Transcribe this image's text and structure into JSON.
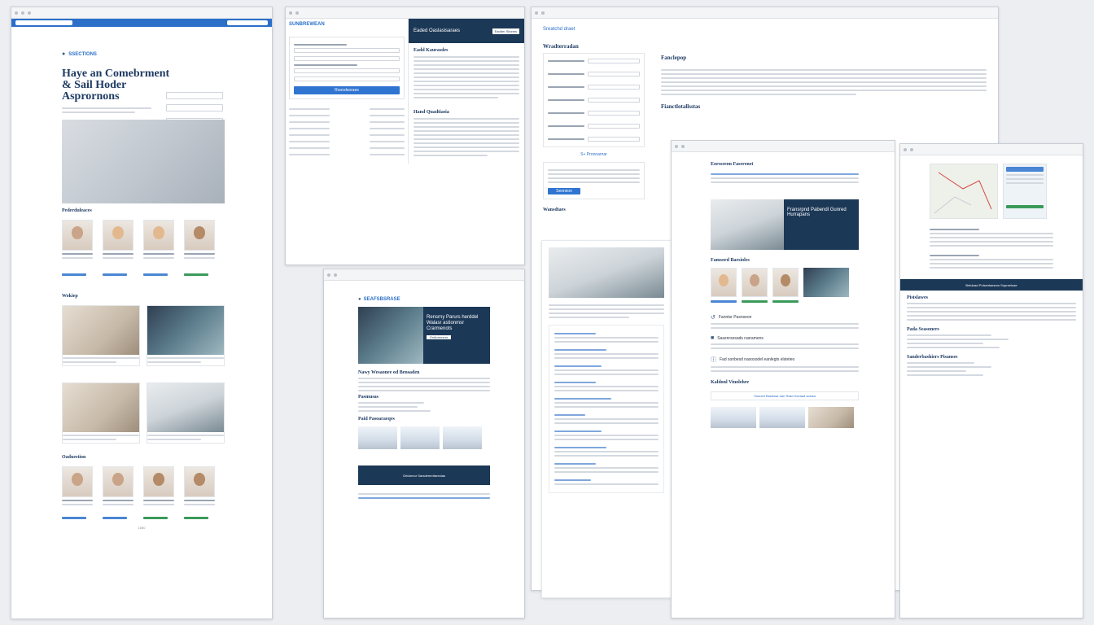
{
  "window1": {
    "brand": "SSECTIONS",
    "hero_title": "Haye an Comebrment & Sail Hoder Asprornons",
    "section_team": "Pederduleaces",
    "section_worksheet": "Wokiep",
    "section_team2": "Oaduestion",
    "page_number": "1000"
  },
  "window2": {
    "logo": "SUNBREWEAN",
    "header_title": "Eaded Oaslasisaraes",
    "header_button": "Eadder Sitones",
    "section1": "Eadd Kaurasdes",
    "section2": "Hand Quadtiasia",
    "submit_label": "Rooodsoraes"
  },
  "window3": {
    "header": "Sreatchd draet",
    "section_form": "Wradterradan",
    "side_title": "Fanclepop",
    "side_title2": "Fianctlotallsstas",
    "section_bottom": "Wansdtaes",
    "button": "Seorsion",
    "blue_link": "S+ Pronnarnar"
  },
  "window4": {
    "brand": "SEAFSBSRASE",
    "banner_text": "Rensrny Parurs herddel Walasr astionmsr Crarmenots",
    "banner_button": "Grdtomesrar",
    "subhead": "Nawy Wesaonee od Bensaden",
    "subhead2": "Pasmusas",
    "section_products": "Paid Pasoaraeqes",
    "footer_band": "Grtdornor Sarsdemrdtareolas"
  },
  "window5": {
    "title": "Eorsseeon Faserenet",
    "banner_text": "Fransrpnd Pabendl Gunred Hurrapans",
    "section": "Famsord Barsioles",
    "bullet1": "Fanntsr Pasnseon",
    "bullet2": "Sasenrsesads rasramens",
    "bullet3": "Fad sonbesd nasosodel eanlegts elsteteo",
    "section2": "Kaldonl Vinolehre",
    "highlight": "Sunned Basiesar dan Rasd hoeaad wobsa"
  },
  "window6": {
    "header_band": "Belulasd Polsenlaesmn Sopreeloae",
    "section1": "Pistslawes",
    "section2": "Pada Seasoners",
    "section3": "Sanderbashiers Pisanses"
  },
  "colors": {
    "accent": "#2b6fc9",
    "dark_banner": "#1c3857",
    "green": "#3a9a5a"
  }
}
